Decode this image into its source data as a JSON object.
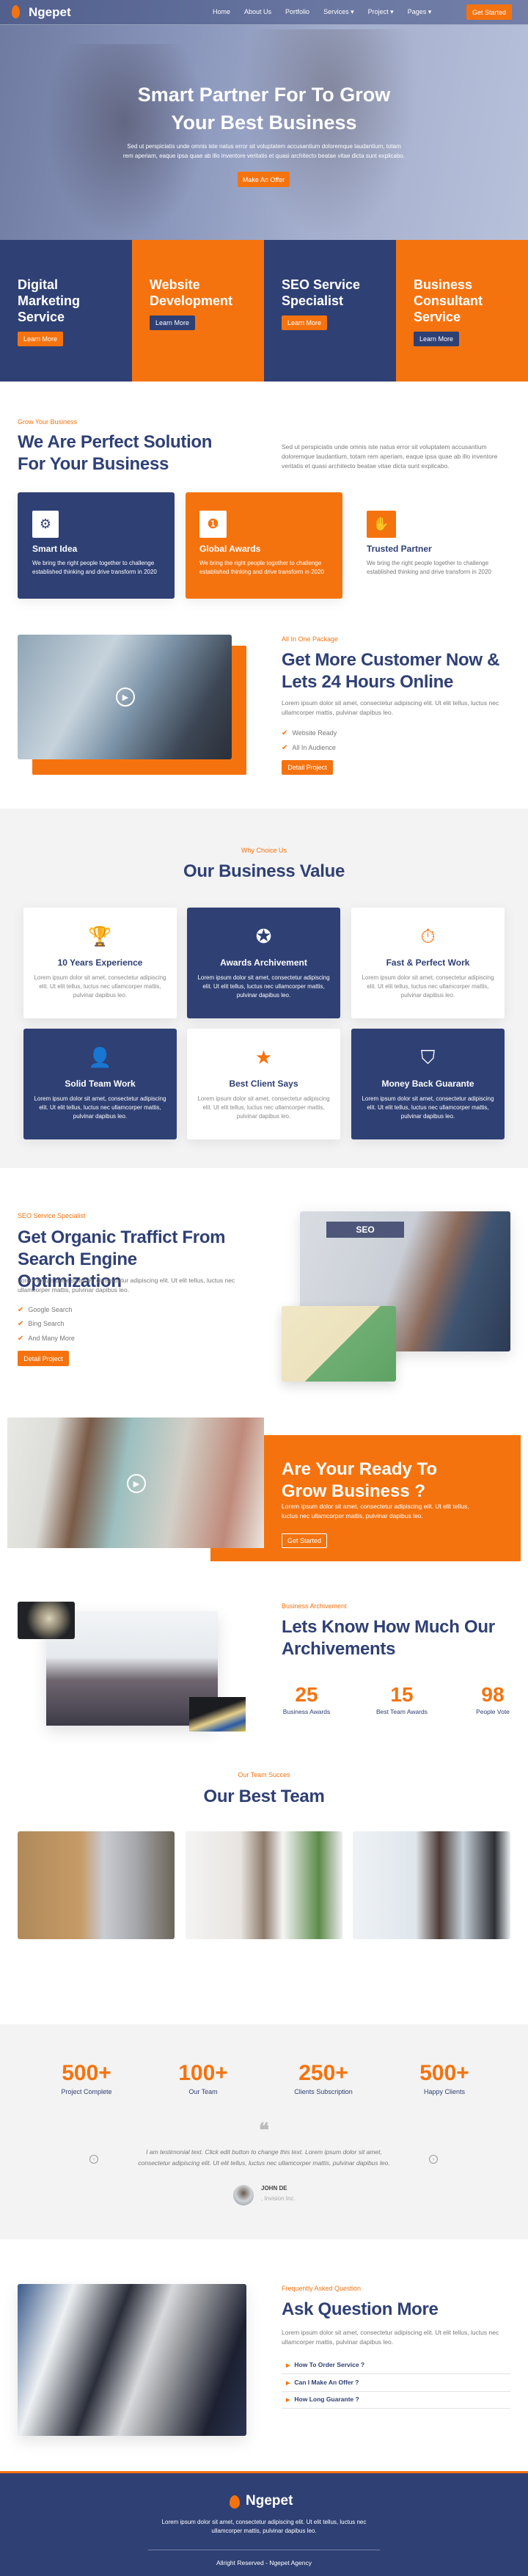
{
  "colors": {
    "navy": "#2f4074",
    "orange": "#f5730f"
  },
  "nav": {
    "brand": "Ngepet",
    "logo_icon": "flame-icon",
    "items": [
      {
        "label": "Home"
      },
      {
        "label": "About Us"
      },
      {
        "label": "Portfolio"
      },
      {
        "label": "Services",
        "dropdown": true
      },
      {
        "label": "Project",
        "dropdown": true
      },
      {
        "label": "Pages",
        "dropdown": true
      }
    ],
    "cta": "Get Started"
  },
  "hero": {
    "title_line1": "Smart Partner For To Grow",
    "title_line2": "Your Best Business",
    "text_line1": "Sed ut perspiciatis unde omnis iste natus error sit voluptatem accusantium doloremque laudantium, totam",
    "text_line2": "rem aperiam, eaque ipsa quae ab illo inventore veritatis et quasi architecto beatae vitae dicta sunt explicabo.",
    "button": "Make An Offer"
  },
  "services": [
    {
      "title": "Digital Marketing Service",
      "button": "Learn More"
    },
    {
      "title": "Website Development",
      "button": "Learn More"
    },
    {
      "title": "SEO Service Specialist",
      "button": "Learn More"
    },
    {
      "title": "Business Consultant Service",
      "button": "Learn More"
    }
  ],
  "solution": {
    "label": "Grow Your Business",
    "title": "We Are Perfect Solution For Your Business",
    "text": "Sed ut perspiciatis unde omnis iste natus error sit voluptatem accusantium doloremque laudantium, totam rem aperiam, eaque ipsa quae ab illo inventore veritatis et quasi architecto beatae vitae dicta sunt explicabo.",
    "features": [
      {
        "icon": "lightbulb-gear-icon",
        "title": "Smart Idea",
        "text": "We bring the right people together to challenge established thinking and drive transform in 2020"
      },
      {
        "icon": "award-ribbon-icon",
        "title": "Global Awards",
        "text": "We bring the right people together to challenge established thinking and drive transform in 2020"
      },
      {
        "icon": "handshake-icon",
        "title": "Trusted Partner",
        "text": "We bring the right people together to challenge established thinking and drive transform in 2020"
      }
    ]
  },
  "package": {
    "label": "All In One Package",
    "title": "Get More Customer Now & Lets 24 Hours Online",
    "text": "Lorem ipsum dolor sit amet, consectetur adipiscing elit. Ut elit tellus, luctus nec ullamcorper mattis, pulvinar dapibus leo.",
    "checks": [
      "Website Ready",
      "All In Audience"
    ],
    "button": "Detail Project"
  },
  "values": {
    "label": "Why Choice Us",
    "title": "Our Business Value",
    "items": [
      {
        "icon": "trophy-icon",
        "title": "10 Years Experience",
        "text": "Lorem ipsum dolor sit amet, consectetur adipiscing elit. Ut elit tellus, luctus nec ullamcorper mattis, pulvinar dapibus leo."
      },
      {
        "icon": "award-icon",
        "title": "Awards Archivement",
        "text": "Lorem ipsum dolor sit amet, consectetur adipiscing elit. Ut elit tellus, luctus nec ullamcorper mattis, pulvinar dapibus leo."
      },
      {
        "icon": "stopwatch-icon",
        "title": "Fast & Perfect Work",
        "text": "Lorem ipsum dolor sit amet, consectetur adipiscing elit. Ut elit tellus, luctus nec ullamcorper mattis, pulvinar dapibus leo."
      },
      {
        "icon": "user-gear-icon",
        "title": "Solid Team Work",
        "text": "Lorem ipsum dolor sit amet, consectetur adipiscing elit. Ut elit tellus, luctus nec ullamcorper mattis, pulvinar dapibus leo."
      },
      {
        "icon": "star-icon",
        "title": "Best Client Says",
        "text": "Lorem ipsum dolor sit amet, consectetur adipiscing elit. Ut elit tellus, luctus nec ullamcorper mattis, pulvinar dapibus leo."
      },
      {
        "icon": "shield-icon",
        "title": "Money Back Guarante",
        "text": "Lorem ipsum dolor sit amet, consectetur adipiscing elit. Ut elit tellus, luctus nec ullamcorper mattis, pulvinar dapibus leo."
      }
    ]
  },
  "seo": {
    "label": "SEO Service Specialist",
    "title": "Get Organic Traffict From Search Engine Optimization",
    "text": "Lorem ipsum dolor sit amet, consectetur adipiscing elit. Ut elit tellus, luctus nec ullamcorper mattis, pulvinar dapibus leo.",
    "checks": [
      "Google Search",
      "Bing Search",
      "And Many More"
    ],
    "button": "Detail Project",
    "image_text": "SEO"
  },
  "ready": {
    "title": "Are Your Ready To Grow Business ?",
    "text": "Lorem ipsum dolor sit amet, consectetur adipiscing elit. Ut elit tellus, luctus nec ullamcorper mattis, pulvinar dapibus leo.",
    "button": "Get Started"
  },
  "achieve": {
    "label": "Business Archivement",
    "title": "Lets Know How Much Our Archivements",
    "stats": [
      {
        "value": "25",
        "label": "Business Awards"
      },
      {
        "value": "15",
        "label": "Best Team Awards"
      },
      {
        "value": "98",
        "label": "People Vote"
      }
    ]
  },
  "team": {
    "label": "Our Team Succes",
    "title": "Our Best Team"
  },
  "counters": [
    {
      "value": "500+",
      "label": "Project Complete"
    },
    {
      "value": "100+",
      "label": "Our Team"
    },
    {
      "value": "250+",
      "label": "Clients Subscription"
    },
    {
      "value": "500+",
      "label": "Happy Clients"
    }
  ],
  "testimonial": {
    "text": "I am testimonial text. Click edit button to change this text. Lorem ipsum dolor sit amet, consectetur adipiscing elit. Ut elit tellus, luctus nec ullamcorper mattis, pulvinar dapibus leo.",
    "name": "JOHN DE",
    "company": ", Invision Inc."
  },
  "faq": {
    "label": "Frequently Asked Question",
    "title": "Ask Question More",
    "text": "Lorem ipsum dolor sit amet, consectetur adipiscing elit. Ut elit tellus, luctus nec ullamcorper mattis, pulvinar dapibus leo.",
    "items": [
      "How To Order Service ?",
      "Can I Make An Offer ?",
      "How Long Guarante ?"
    ]
  },
  "footer": {
    "brand": "Ngepet",
    "text": "Lorem ipsum dolor sit amet, consectetur adipiscing elit. Ut elit tellus, luctus nec ullamcorper mattis, pulvinar dapibus leo.",
    "copyright": "Allright Reserved - Ngepet Agency"
  }
}
